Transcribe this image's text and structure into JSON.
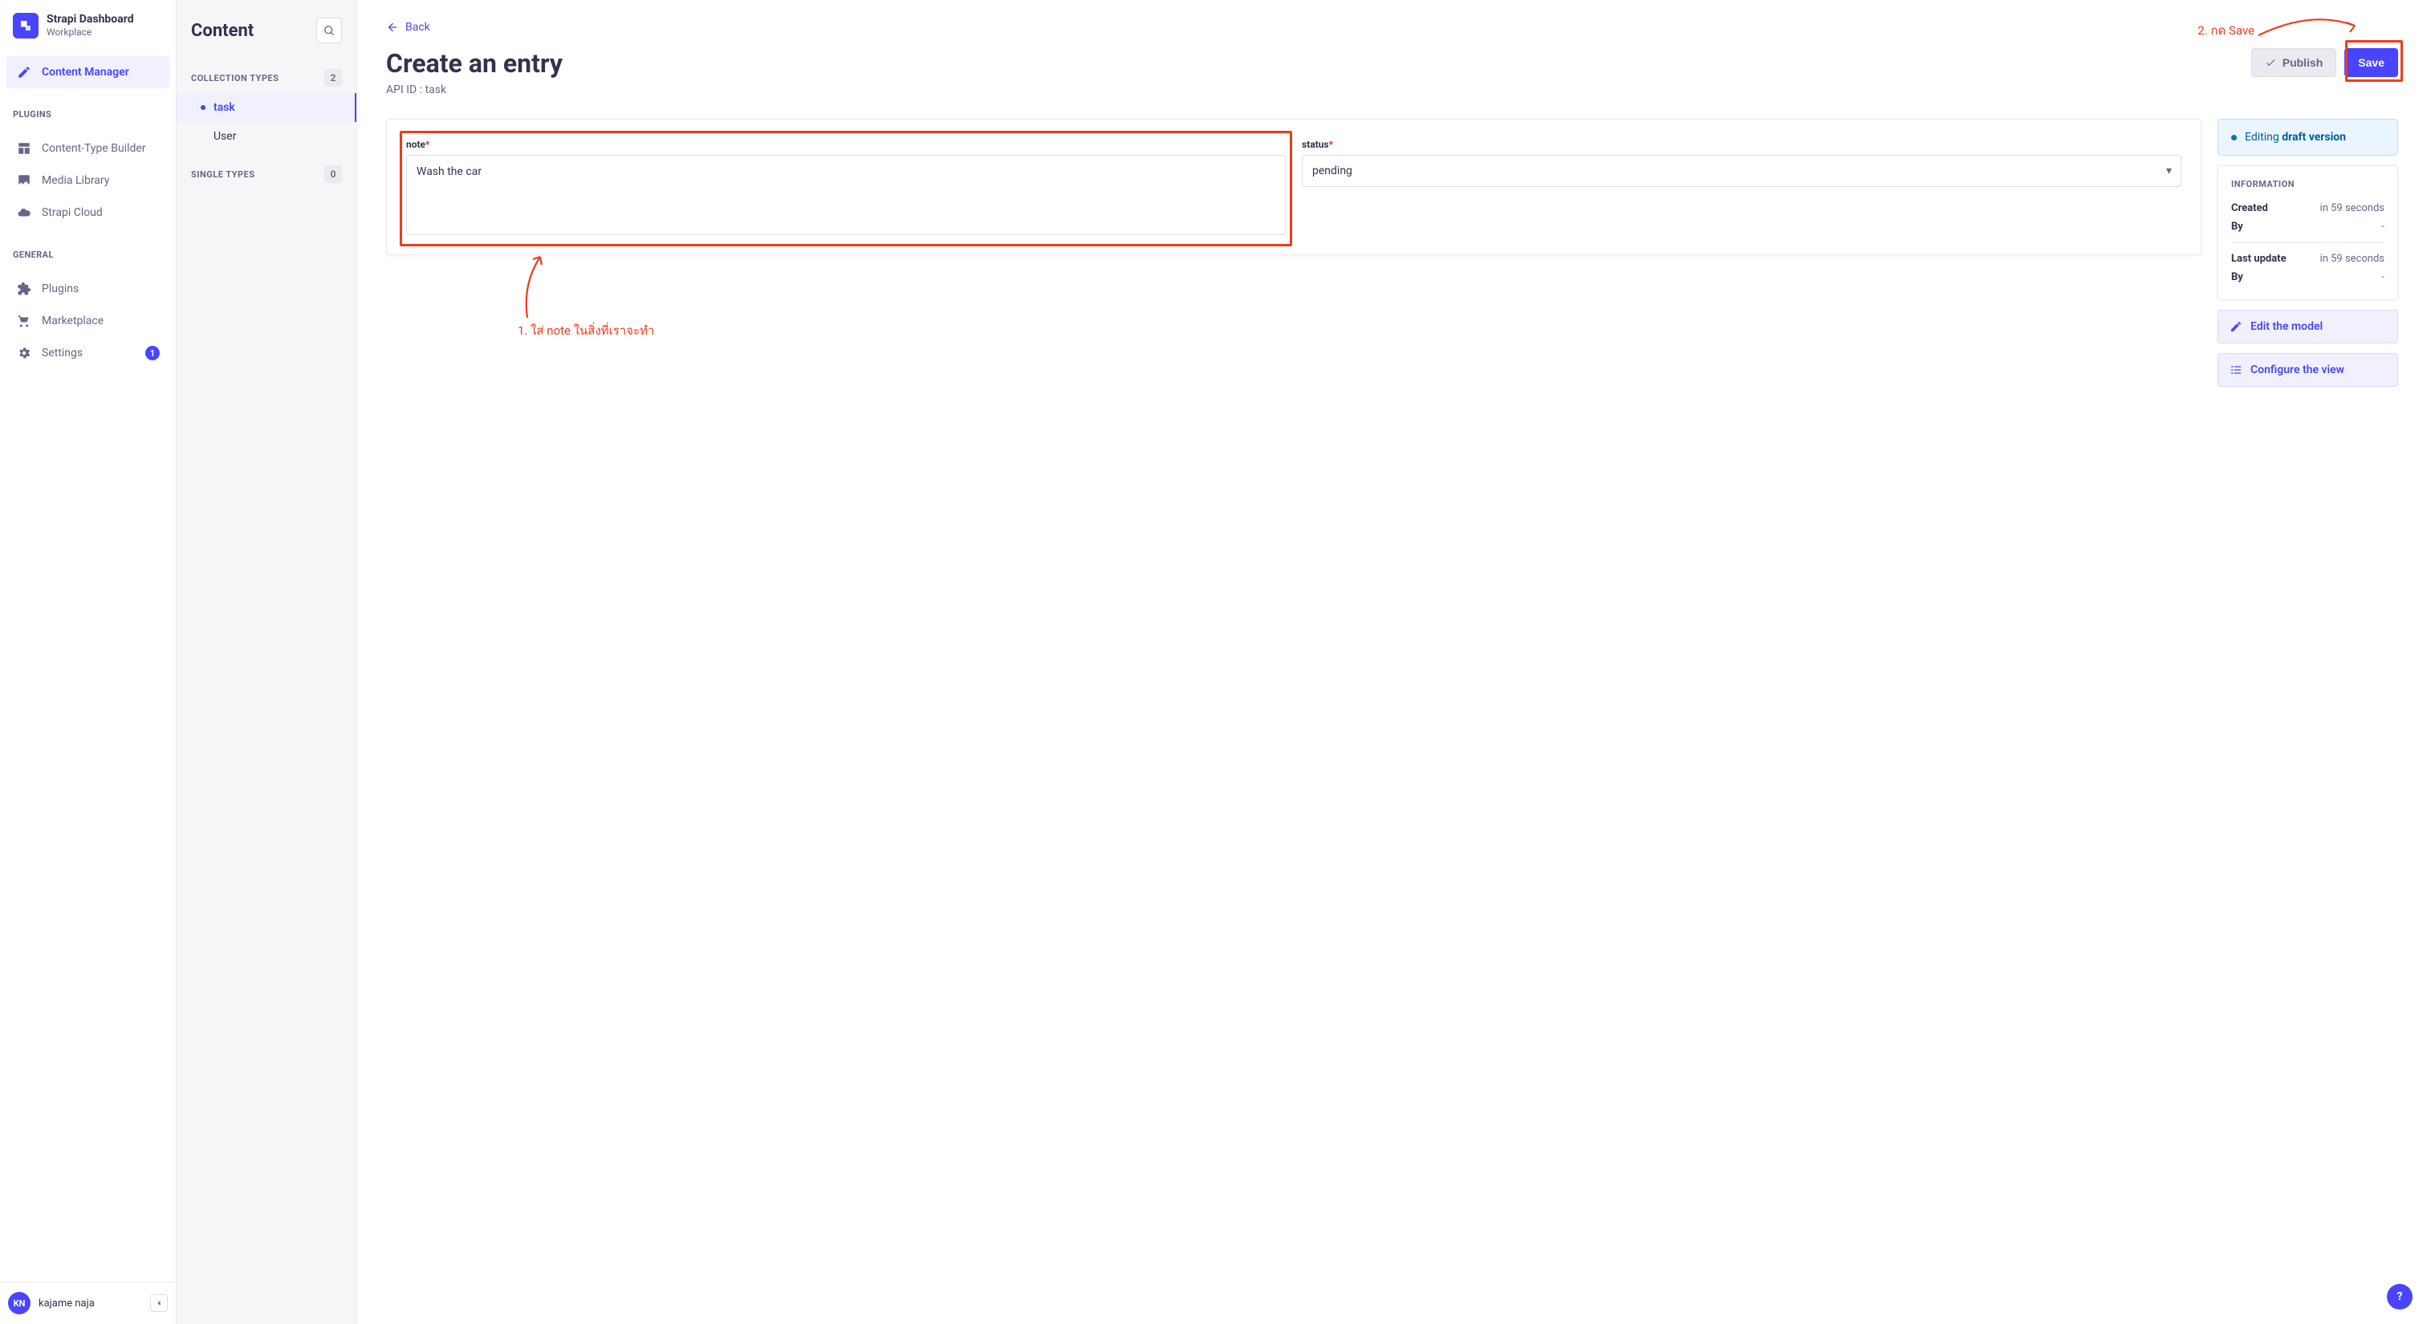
{
  "brand": {
    "title": "Strapi Dashboard",
    "subtitle": "Workplace"
  },
  "mainNav": {
    "contentManager": "Content Manager",
    "pluginsHeading": "PLUGINS",
    "contentTypeBuilder": "Content-Type Builder",
    "mediaLibrary": "Media Library",
    "strapiCloud": "Strapi Cloud",
    "generalHeading": "GENERAL",
    "plugins": "Plugins",
    "marketplace": "Marketplace",
    "settings": "Settings",
    "settingsBadge": "1"
  },
  "footer": {
    "avatar": "KN",
    "username": "kajame naja"
  },
  "subSidebar": {
    "title": "Content",
    "collectionHeading": "COLLECTION TYPES",
    "collectionCount": "2",
    "items": [
      "task",
      "User"
    ],
    "singleHeading": "SINGLE TYPES",
    "singleCount": "0"
  },
  "page": {
    "back": "Back",
    "title": "Create an entry",
    "apiId": "API ID : task",
    "publish": "Publish",
    "save": "Save"
  },
  "form": {
    "noteLabel": "note",
    "noteValue": "Wash the car",
    "statusLabel": "status",
    "statusValue": "pending"
  },
  "version": {
    "prefix": "Editing ",
    "bold": "draft version"
  },
  "info": {
    "heading": "INFORMATION",
    "createdK": "Created",
    "createdV": "in 59 seconds",
    "byK": "By",
    "byV": "-",
    "updatedK": "Last update",
    "updatedV": "in 59 seconds",
    "by2K": "By",
    "by2V": "-"
  },
  "links": {
    "editModel": "Edit the model",
    "configure": "Configure the view"
  },
  "annotations": {
    "saveText": "2. กด Save",
    "noteText": "1. ใส่ note ในสิ่งที่เราจะทำ"
  },
  "helpFab": "?"
}
